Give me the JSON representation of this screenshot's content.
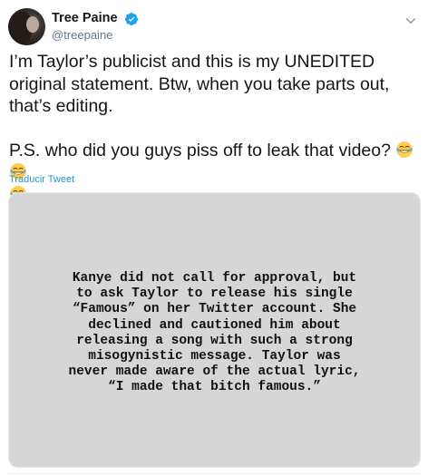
{
  "tweet": {
    "author": {
      "display_name": "Tree Paine",
      "handle": "@treepaine",
      "verified": true,
      "avatar_icon": "profile-photo"
    },
    "text_paragraph_1": "I’m Taylor’s publicist and this is my UNEDITED original statement. Btw, when you take parts out, that’s editing.",
    "text_paragraph_2": "P.S. who did you guys piss off to leak that video?",
    "emojis": [
      "face-with-tears-of-joy",
      "face-with-tears-of-joy",
      "face-with-tears-of-joy"
    ],
    "translate_label": "Traducir Tweet",
    "media": {
      "text": "Kanye did not call for approval, but\nto ask Taylor to release his single\n“Famous” on her Twitter account. She\ndeclined and cautioned him about\nreleasing a song with such a strong\nmisogynistic message. Taylor was\nnever made aware of the actual lyric,\n“I made that bitch famous.”",
      "background": "#d6d6d6"
    }
  },
  "colors": {
    "link": "#1b95e0",
    "verified": "#1da1f2",
    "secondary_text": "#657786"
  }
}
